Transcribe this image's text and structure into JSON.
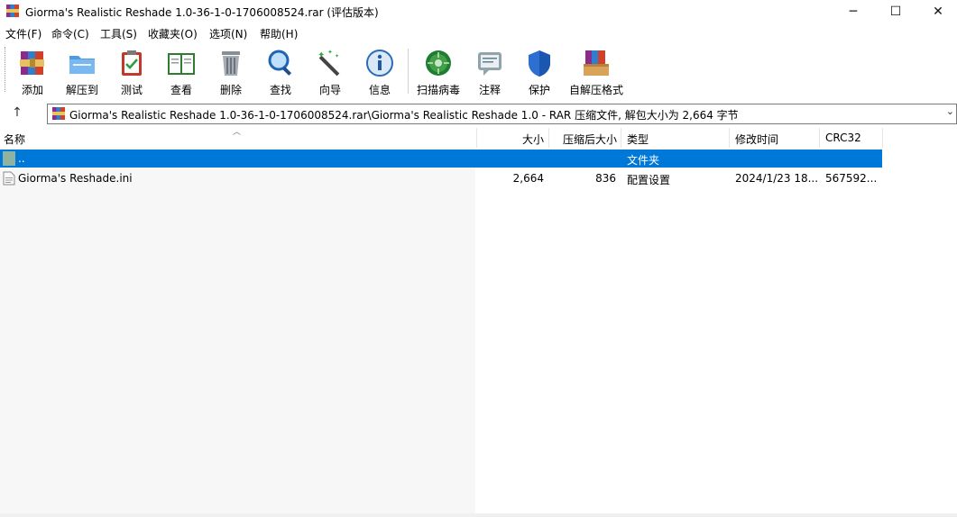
{
  "window": {
    "title": "Giorma's Realistic Reshade 1.0-36-1-0-1706008524.rar (评估版本)",
    "minimize_glyph": "─",
    "maximize_glyph": "☐",
    "close_glyph": "✕"
  },
  "menu": [
    "文件(F)",
    "命令(C)",
    "工具(S)",
    "收藏夹(O)",
    "选项(N)",
    "帮助(H)"
  ],
  "toolbar": [
    {
      "label": "添加",
      "icon": "archive-add-icon"
    },
    {
      "label": "解压到",
      "icon": "extract-folder-icon"
    },
    {
      "label": "测试",
      "icon": "test-clipboard-icon"
    },
    {
      "label": "查看",
      "icon": "view-book-icon"
    },
    {
      "label": "删除",
      "icon": "trash-icon"
    },
    {
      "label": "查找",
      "icon": "magnifier-icon"
    },
    {
      "label": "向导",
      "icon": "wizard-wand-icon"
    },
    {
      "label": "信息",
      "icon": "info-icon"
    },
    {
      "label": "扫描病毒",
      "icon": "virus-scan-icon"
    },
    {
      "label": "注释",
      "icon": "comment-icon"
    },
    {
      "label": "保护",
      "icon": "shield-icon"
    },
    {
      "label": "自解压格式",
      "icon": "sfx-archive-icon"
    }
  ],
  "address": {
    "path": "Giorma's Realistic Reshade 1.0-36-1-0-1706008524.rar\\Giorma's Realistic Reshade 1.0 - RAR 压缩文件, 解包大小为 2,664 字节"
  },
  "columns": {
    "name": "名称",
    "size": "大小",
    "packed": "压缩后大小",
    "type": "类型",
    "modified": "修改时间",
    "crc": "CRC32"
  },
  "rows": [
    {
      "name": "..",
      "size": "",
      "packed": "",
      "type": "文件夹",
      "modified": "",
      "crc": "",
      "selected": true
    },
    {
      "name": "Giorma's Reshade.ini",
      "size": "2,664",
      "packed": "836",
      "type": "配置设置",
      "modified": "2024/1/23 18...",
      "crc": "567592...",
      "selected": false
    }
  ],
  "colors": {
    "selection": "#0078d7",
    "name_column_bg": "#f7f7f7"
  }
}
